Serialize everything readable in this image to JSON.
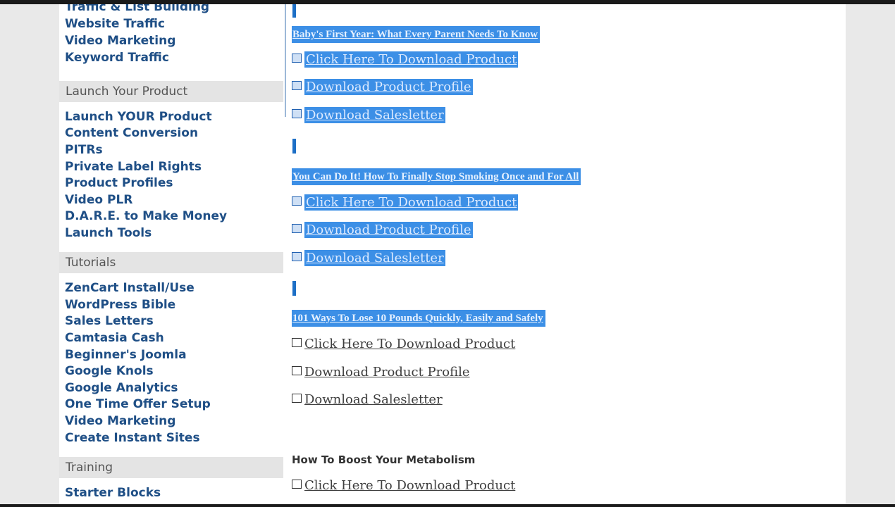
{
  "sidebar": {
    "group_top": [
      "Traffic & List Building",
      "Website Traffic",
      "Video Marketing",
      "Keyword Traffic"
    ],
    "launch": {
      "heading": "Launch Your Product",
      "items": [
        "Launch YOUR Product",
        "Content Conversion",
        "PITRs",
        "Private Label Rights",
        "Product Profiles",
        "Video PLR",
        "D.A.R.E. to Make Money",
        "Launch Tools"
      ]
    },
    "tutorials": {
      "heading": "Tutorials",
      "items": [
        "ZenCart Install/Use",
        "WordPress Bible",
        "Sales Letters",
        "Camtasia Cash",
        "Beginner's Joomla",
        "Google Knols",
        "Google Analytics",
        "One Time Offer Setup",
        "Video Marketing",
        "Create Instant Sites"
      ]
    },
    "training": {
      "heading": "Training",
      "items": [
        "Starter Blocks"
      ]
    }
  },
  "products": [
    {
      "title": "Baby's First Year: What Every Parent Needs To Know",
      "download": "Click Here To Download Product",
      "profile": "Download Product Profile",
      "salesletter": "Download Salesletter"
    },
    {
      "title": "You Can Do It! How To Finally Stop Smoking Once and For All",
      "download": "Click Here To Download Product",
      "profile": "Download Product Profile",
      "salesletter": "Download Salesletter"
    },
    {
      "title": "101 Ways To Lose 10 Pounds Quickly, Easily and Safely",
      "download": "Click Here To Download Product",
      "profile": "Download Product Profile",
      "salesletter": "Download Salesletter"
    },
    {
      "title": "How To Boost Your Metabolism",
      "download": "Click Here To Download Product"
    }
  ],
  "colors": {
    "selection": "#3c8fe6",
    "sidebar_link": "#1f4f86",
    "section_bg": "#e4e4e4"
  }
}
